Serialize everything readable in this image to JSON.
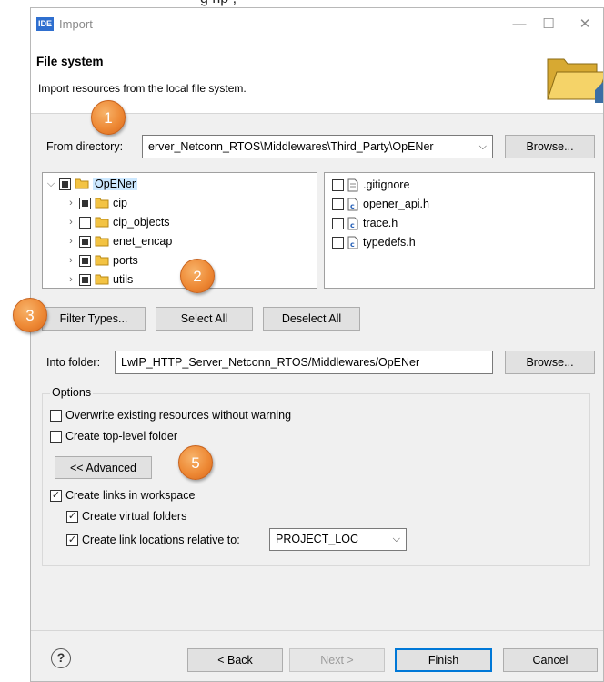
{
  "caption_fragment": "g                  np , ",
  "window": {
    "logo": "IDE",
    "title": "Import",
    "minimize": "—",
    "maximize": "☐",
    "close": "✕"
  },
  "banner": {
    "title": "File system",
    "description": "Import resources from the local file system."
  },
  "from_directory": {
    "label": "From directory:",
    "value": "erver_Netconn_RTOS\\Middlewares\\Third_Party\\OpENer",
    "browse": "Browse..."
  },
  "tree": [
    {
      "label": "OpENer",
      "state": "partial",
      "expanded": true
    },
    {
      "label": "cip",
      "state": "partial"
    },
    {
      "label": "cip_objects",
      "state": "unchecked"
    },
    {
      "label": "enet_encap",
      "state": "partial"
    },
    {
      "label": "ports",
      "state": "partial"
    },
    {
      "label": "utils",
      "state": "partial"
    }
  ],
  "files": [
    {
      "label": ".gitignore",
      "icon": "text-file-icon"
    },
    {
      "label": "opener_api.h",
      "icon": "c-header-icon"
    },
    {
      "label": "trace.h",
      "icon": "c-header-icon"
    },
    {
      "label": "typedefs.h",
      "icon": "c-header-icon"
    }
  ],
  "actions": {
    "filter_types": "Filter Types...",
    "select_all": "Select All",
    "deselect_all": "Deselect All"
  },
  "into_folder": {
    "label": "Into folder:",
    "value": "LwIP_HTTP_Server_Netconn_RTOS/Middlewares/OpENer",
    "browse": "Browse..."
  },
  "options": {
    "legend": "Options",
    "overwrite": {
      "label": "Overwrite existing resources without warning",
      "checked": false
    },
    "top_level": {
      "label": "Create top-level folder",
      "checked": false
    },
    "advanced_button": "<< Advanced",
    "create_links": {
      "label": "Create links in workspace",
      "checked": true
    },
    "virtual_folders": {
      "label": "Create virtual folders",
      "checked": true
    },
    "relative_to": {
      "label": "Create link locations relative to:",
      "checked": true,
      "value": "PROJECT_LOC"
    }
  },
  "footer": {
    "help": "?",
    "back": "< Back",
    "next": "Next >",
    "finish": "Finish",
    "cancel": "Cancel"
  },
  "badges": [
    "1",
    "2",
    "3",
    "5"
  ],
  "colors": {
    "badge": "#ee8a36",
    "accent": "#0078d7",
    "folder": "#f3c343"
  }
}
